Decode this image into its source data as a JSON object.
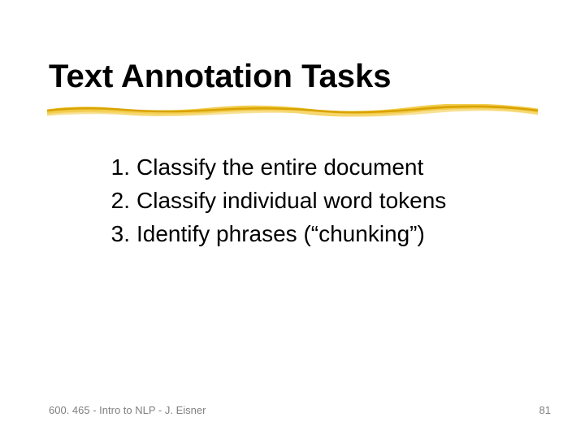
{
  "title": "Text Annotation Tasks",
  "items": [
    {
      "num": "1.",
      "text": "Classify the entire document"
    },
    {
      "num": "2.",
      "text": "Classify individual word tokens"
    },
    {
      "num": "3.",
      "text": "Identify phrases (“chunking”)"
    }
  ],
  "footer_left": "600. 465 - Intro to NLP - J. Eisner",
  "footer_right": "81",
  "colors": {
    "underline_dark": "#d9a300",
    "underline_light": "#f2cc4d"
  }
}
